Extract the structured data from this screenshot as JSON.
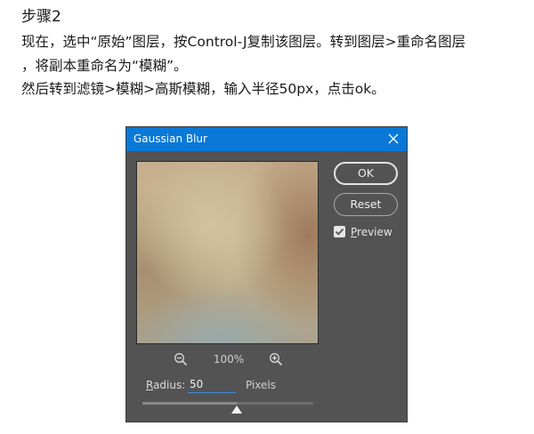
{
  "article": {
    "step_title": "步骤2",
    "lines": [
      "现在，选中“原始”图层，按Control-J复制该图层。转到图层>重命名图层",
      "，将副本重命名为“模糊”。",
      "然后转到滤镜>模糊>高斯模糊，输入半径50px，点击ok。"
    ]
  },
  "dialog": {
    "title": "Gaussian Blur",
    "close_icon": "close-icon",
    "ok_label": "OK",
    "reset_label": "Reset",
    "preview": {
      "checked": true,
      "label_underlined": "P",
      "label_rest": "review"
    },
    "zoom": {
      "level": "100%",
      "zoom_out_icon": "zoom-out-icon",
      "zoom_in_icon": "zoom-in-icon"
    },
    "radius": {
      "label_underlined": "R",
      "label_rest": "adius:",
      "value": "50",
      "unit": "Pixels",
      "slider_fraction": 0.55
    },
    "colors": {
      "titlebar": "#0a78d7",
      "panel": "#535353",
      "input_underline": "#3d8fdc"
    }
  }
}
